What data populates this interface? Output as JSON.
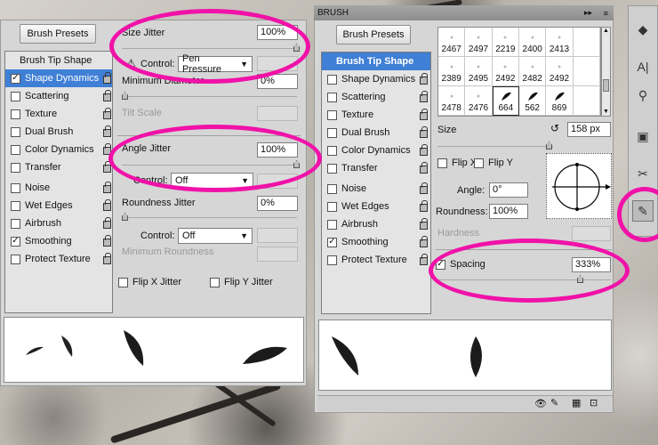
{
  "left_panel": {
    "brush_presets_button": "Brush Presets",
    "brush_tip_shape": "Brush Tip Shape",
    "options": [
      {
        "label": "Shape Dynamics",
        "checked": true,
        "selected": true
      },
      {
        "label": "Scattering",
        "checked": false
      },
      {
        "label": "Texture",
        "checked": false
      },
      {
        "label": "Dual Brush",
        "checked": false
      },
      {
        "label": "Color Dynamics",
        "checked": false
      },
      {
        "label": "Transfer",
        "checked": false
      },
      {
        "label": "Noise",
        "checked": false
      },
      {
        "label": "Wet Edges",
        "checked": false
      },
      {
        "label": "Airbrush",
        "checked": false
      },
      {
        "label": "Smoothing",
        "checked": true
      },
      {
        "label": "Protect Texture",
        "checked": false
      }
    ],
    "size_jitter_label": "Size Jitter",
    "size_jitter_value": "100%",
    "control_label": "Control:",
    "size_control": "Pen Pressure",
    "min_diameter_label": "Minimum Diameter",
    "min_diameter_value": "0%",
    "tilt_scale_label": "Tilt Scale",
    "angle_jitter_label": "Angle Jitter",
    "angle_jitter_value": "100%",
    "angle_control": "Off",
    "roundness_jitter_label": "Roundness Jitter",
    "roundness_jitter_value": "0%",
    "roundness_control": "Off",
    "min_roundness_label": "Minimum Roundness",
    "flip_x_jitter": "Flip X Jitter",
    "flip_y_jitter": "Flip Y Jitter"
  },
  "right_panel": {
    "title": "BRUSH",
    "brush_presets_button": "Brush Presets",
    "brush_tip_shape": "Brush Tip Shape",
    "options": [
      {
        "label": "Shape Dynamics",
        "checked": false
      },
      {
        "label": "Scattering",
        "checked": false
      },
      {
        "label": "Texture",
        "checked": false
      },
      {
        "label": "Dual Brush",
        "checked": false
      },
      {
        "label": "Color Dynamics",
        "checked": false
      },
      {
        "label": "Transfer",
        "checked": false
      },
      {
        "label": "Noise",
        "checked": false
      },
      {
        "label": "Wet Edges",
        "checked": false
      },
      {
        "label": "Airbrush",
        "checked": false
      },
      {
        "label": "Smoothing",
        "checked": true
      },
      {
        "label": "Protect Texture",
        "checked": false
      }
    ],
    "brush_grid": [
      [
        "2467",
        "2497",
        "2219",
        "2400",
        "2413"
      ],
      [
        "2389",
        "2495",
        "2492",
        "2482",
        "2492"
      ],
      [
        "2478",
        "2476",
        "664",
        "562",
        "869"
      ]
    ],
    "size_label": "Size",
    "size_value": "158 px",
    "flip_x": "Flip X",
    "flip_y": "Flip Y",
    "angle_label": "Angle:",
    "angle_value": "0°",
    "roundness_label": "Roundness:",
    "roundness_value": "100%",
    "hardness_label": "Hardness",
    "spacing_label": "Spacing",
    "spacing_value": "333%",
    "spacing_checked": true
  },
  "accent_color": "#f012a8",
  "selection_color": "#3f7fd5"
}
